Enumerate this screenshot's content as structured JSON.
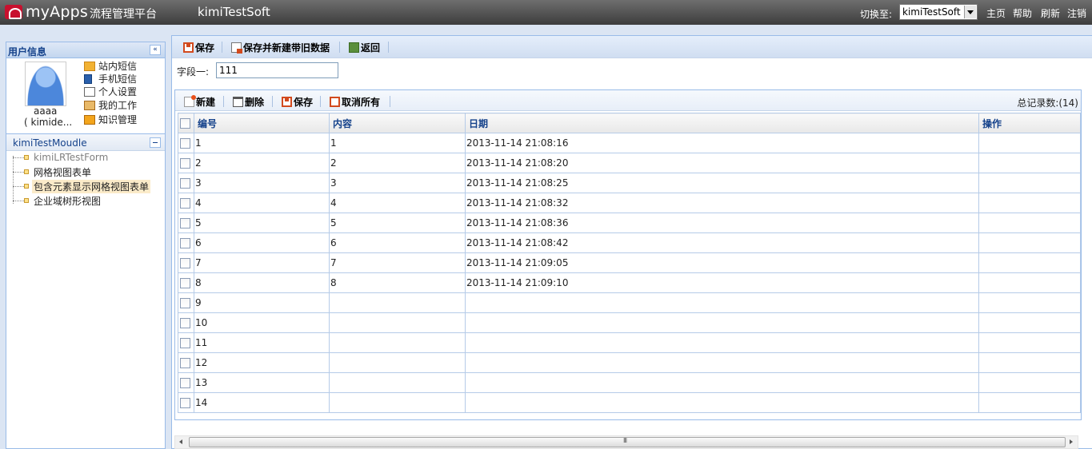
{
  "topbar": {
    "brand": "myApps",
    "brand_sub": "流程管理平台",
    "app_name": "kimiTestSoft",
    "switch_label": "切换至:",
    "switch_value": "kimiTestSoft",
    "links": [
      "主页",
      "帮助",
      "刷新",
      "注销"
    ]
  },
  "user_panel": {
    "title": "用户信息",
    "collapse_glyph": "«",
    "user_name": "aaaa",
    "user_id": "( kimide...",
    "menu": [
      "站内短信",
      "手机短信",
      "个人设置",
      "我的工作",
      "知识管理"
    ]
  },
  "module": {
    "title": "kimiTestMoudle",
    "items": [
      {
        "label": "kimiLRTestForm",
        "state": "dim"
      },
      {
        "label": "网格视图表单",
        "state": "normal"
      },
      {
        "label": "包含元素显示网格视图表单",
        "state": "active"
      },
      {
        "label": "企业域树形视图",
        "state": "normal"
      }
    ]
  },
  "main_toolbar": {
    "save": "保存",
    "save_new": "保存并新建带旧数据",
    "back": "返回"
  },
  "field": {
    "label": "字段一:",
    "value": "111"
  },
  "grid_toolbar": {
    "new": "新建",
    "delete": "删除",
    "save": "保存",
    "cancel_all": "取消所有",
    "record_count": "总记录数:(14)"
  },
  "grid": {
    "columns": [
      "编号",
      "内容",
      "日期",
      "操作"
    ],
    "rows": [
      {
        "id": "1",
        "content": "1",
        "date": "2013-11-14 21:08:16"
      },
      {
        "id": "2",
        "content": "2",
        "date": "2013-11-14 21:08:20"
      },
      {
        "id": "3",
        "content": "3",
        "date": "2013-11-14 21:08:25"
      },
      {
        "id": "4",
        "content": "4",
        "date": "2013-11-14 21:08:32"
      },
      {
        "id": "5",
        "content": "5",
        "date": "2013-11-14 21:08:36"
      },
      {
        "id": "6",
        "content": "6",
        "date": "2013-11-14 21:08:42"
      },
      {
        "id": "7",
        "content": "7",
        "date": "2013-11-14 21:09:05"
      },
      {
        "id": "8",
        "content": "8",
        "date": "2013-11-14 21:09:10"
      },
      {
        "id": "9",
        "content": "",
        "date": ""
      },
      {
        "id": "10",
        "content": "",
        "date": ""
      },
      {
        "id": "11",
        "content": "",
        "date": ""
      },
      {
        "id": "12",
        "content": "",
        "date": ""
      },
      {
        "id": "13",
        "content": "",
        "date": ""
      },
      {
        "id": "14",
        "content": "",
        "date": ""
      }
    ]
  }
}
